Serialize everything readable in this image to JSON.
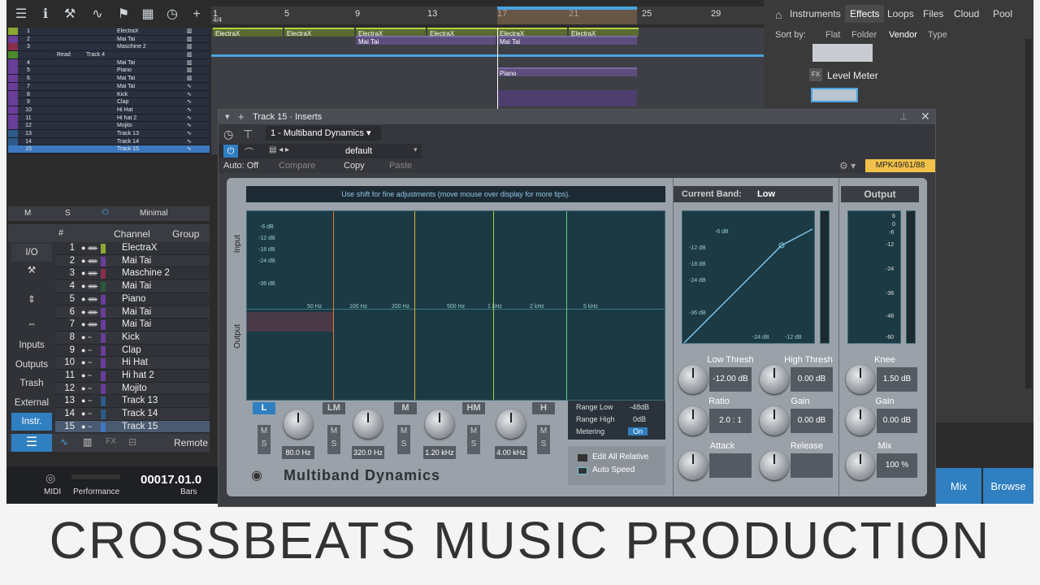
{
  "ruler": [
    "1",
    "4/4",
    "5",
    "9",
    "13",
    "17",
    "21",
    "25",
    "29"
  ],
  "tracks": [
    {
      "n": "1",
      "name": "ElectraX",
      "color": "#8aa832"
    },
    {
      "n": "2",
      "name": "Mai Tai",
      "color": "#6a3d9a"
    },
    {
      "n": "3",
      "name": "Maschine 2",
      "color": "#8a2d4a"
    },
    {
      "n": "",
      "name": "Read",
      "color": "#4a8a2d",
      "sub": "Track 4"
    },
    {
      "n": "4",
      "name": "Mai Tai",
      "color": "#6a3d9a"
    },
    {
      "n": "5",
      "name": "Piano",
      "color": "#6a3d9a"
    },
    {
      "n": "6",
      "name": "Mai Tai",
      "color": "#6a3d9a"
    },
    {
      "n": "7",
      "name": "Mai Tai",
      "color": "#6a3d9a"
    },
    {
      "n": "8",
      "name": "Kick",
      "color": "#6a3d9a"
    },
    {
      "n": "9",
      "name": "Clap",
      "color": "#6a3d9a"
    },
    {
      "n": "10",
      "name": "Hi Hat",
      "color": "#6a3d9a"
    },
    {
      "n": "11",
      "name": "Hi hat 2",
      "color": "#6a3d9a"
    },
    {
      "n": "12",
      "name": "Mojito",
      "color": "#6a3d9a"
    },
    {
      "n": "13",
      "name": "Track 13",
      "color": "#2d5a8a"
    },
    {
      "n": "14",
      "name": "Track 14",
      "color": "#2d5a8a"
    },
    {
      "n": "15",
      "name": "Track 15",
      "color": "#3d78c0"
    }
  ],
  "clips": {
    "c1": "ElectraX",
    "c2": "Mai Tai",
    "c3": "Piano"
  },
  "browser": {
    "tabs": [
      "Instruments",
      "Effects",
      "Loops",
      "Files",
      "Cloud",
      "Pool"
    ],
    "sort_label": "Sort by:",
    "sort": [
      "Flat",
      "Folder",
      "Vendor",
      "Type"
    ],
    "item": "Level Meter",
    "fx": "FX"
  },
  "mixer_header": {
    "m": "M",
    "s": "S",
    "mode": "Minimal",
    "channel": "Channel",
    "group": "Group",
    "hash": "#"
  },
  "side_buttons": [
    "I/O",
    "Inputs",
    "Outputs",
    "Trash",
    "External",
    "Instr."
  ],
  "channels": [
    {
      "n": "1",
      "name": "ElectraX",
      "icon": "● ᚔ",
      "color": "#8aa832"
    },
    {
      "n": "2",
      "name": "Mai Tai",
      "icon": "● ᚔ",
      "color": "#6a3d9a"
    },
    {
      "n": "3",
      "name": "Maschine 2",
      "icon": "● ᚔ",
      "color": "#8a2d4a"
    },
    {
      "n": "4",
      "name": "Mai Tai",
      "icon": "● ᚔ",
      "color": "#2d5a3a"
    },
    {
      "n": "5",
      "name": "Piano",
      "icon": "● ᚔ",
      "color": "#6a3d9a"
    },
    {
      "n": "6",
      "name": "Mai Tai",
      "icon": "● ᚔ",
      "color": "#6a3d9a"
    },
    {
      "n": "7",
      "name": "Mai Tai",
      "icon": "● ᚔ",
      "color": "#6a3d9a"
    },
    {
      "n": "8",
      "name": "Kick",
      "icon": "● ~",
      "color": "#6a3d9a"
    },
    {
      "n": "9",
      "name": "Clap",
      "icon": "● ~",
      "color": "#6a3d9a"
    },
    {
      "n": "10",
      "name": "Hi Hat",
      "icon": "● ~",
      "color": "#6a3d9a"
    },
    {
      "n": "11",
      "name": "Hi hat 2",
      "icon": "● ~",
      "color": "#6a3d9a"
    },
    {
      "n": "12",
      "name": "Mojito",
      "icon": "● ~",
      "color": "#6a3d9a"
    },
    {
      "n": "13",
      "name": "Track 13",
      "icon": "● ~",
      "color": "#2d5a8a"
    },
    {
      "n": "14",
      "name": "Track 14",
      "icon": "● ~",
      "color": "#2d5a8a"
    },
    {
      "n": "15",
      "name": "Track 15",
      "icon": "● ~",
      "color": "#3d78c0"
    }
  ],
  "footer": {
    "remote": "Remote",
    "midi": "MIDI",
    "performance": "Performance",
    "time": "00017.01.0",
    "bars": "Bars",
    "fx": "FX"
  },
  "plugin": {
    "title": "Track 15 · Inserts",
    "insert": "1 - Multiband Dynamics",
    "preset": "default",
    "auto": "Auto: Off",
    "compare": "Compare",
    "copy": "Copy",
    "paste": "Paste",
    "device": "MPK49/61/88",
    "tip": "Use shift for fine adjustments (move mouse over display for more tips).",
    "input": "Input",
    "output": "Output",
    "db_ticks": [
      "-6 dB",
      "-12 dB",
      "-18 dB",
      "-24 dB",
      "-36 dB"
    ],
    "freq_ticks": [
      "50 Hz",
      "100 Hz",
      "200 Hz",
      "500 Hz",
      "1 kHz",
      "2 kHz",
      "5 kHz"
    ],
    "bands": [
      "L",
      "LM",
      "M",
      "HM",
      "H"
    ],
    "freqs": [
      "80.0 Hz",
      "320.0 Hz",
      "1.20 kHz",
      "4.00 kHz"
    ],
    "range_low_label": "Range Low",
    "range_low": "-48dB",
    "range_high_label": "Range High",
    "range_high": "0dB",
    "metering_label": "Metering",
    "metering": "On",
    "edit_all": "Edit All Relative",
    "auto_speed": "Auto Speed",
    "name": "Multiband Dynamics",
    "current_band_label": "Current Band:",
    "current_band": "Low",
    "output_label": "Output",
    "curve_ticks": [
      "-6 dB",
      "-12 dB",
      "-18 dB",
      "-24 dB",
      "-36 dB"
    ],
    "curve_xticks": [
      "-24 dB",
      "-12 dB"
    ],
    "out_ticks": [
      "6",
      "0",
      "-6",
      "-12",
      "-24",
      "-36",
      "-48",
      "-60"
    ],
    "low_thresh": "Low Thresh",
    "low_thresh_v": "-12.00 dB",
    "high_thresh": "High Thresh",
    "high_thresh_v": "0.00 dB",
    "ratio": "Ratio",
    "ratio_v": "2.0 : 1",
    "gain": "Gain",
    "gain_v": "0.00 dB",
    "attack": "Attack",
    "release": "Release",
    "knee": "Knee",
    "knee_v": "1.50 dB",
    "out_gain": "Gain",
    "out_gain_v": "0.00 dB",
    "mix": "Mix",
    "mix_v": "100 %",
    "m": "M",
    "s": "S"
  },
  "buttons": {
    "mix": "Mix",
    "browse": "Browse"
  },
  "banner": "CROSSBEATS MUSIC PRODUCTION"
}
